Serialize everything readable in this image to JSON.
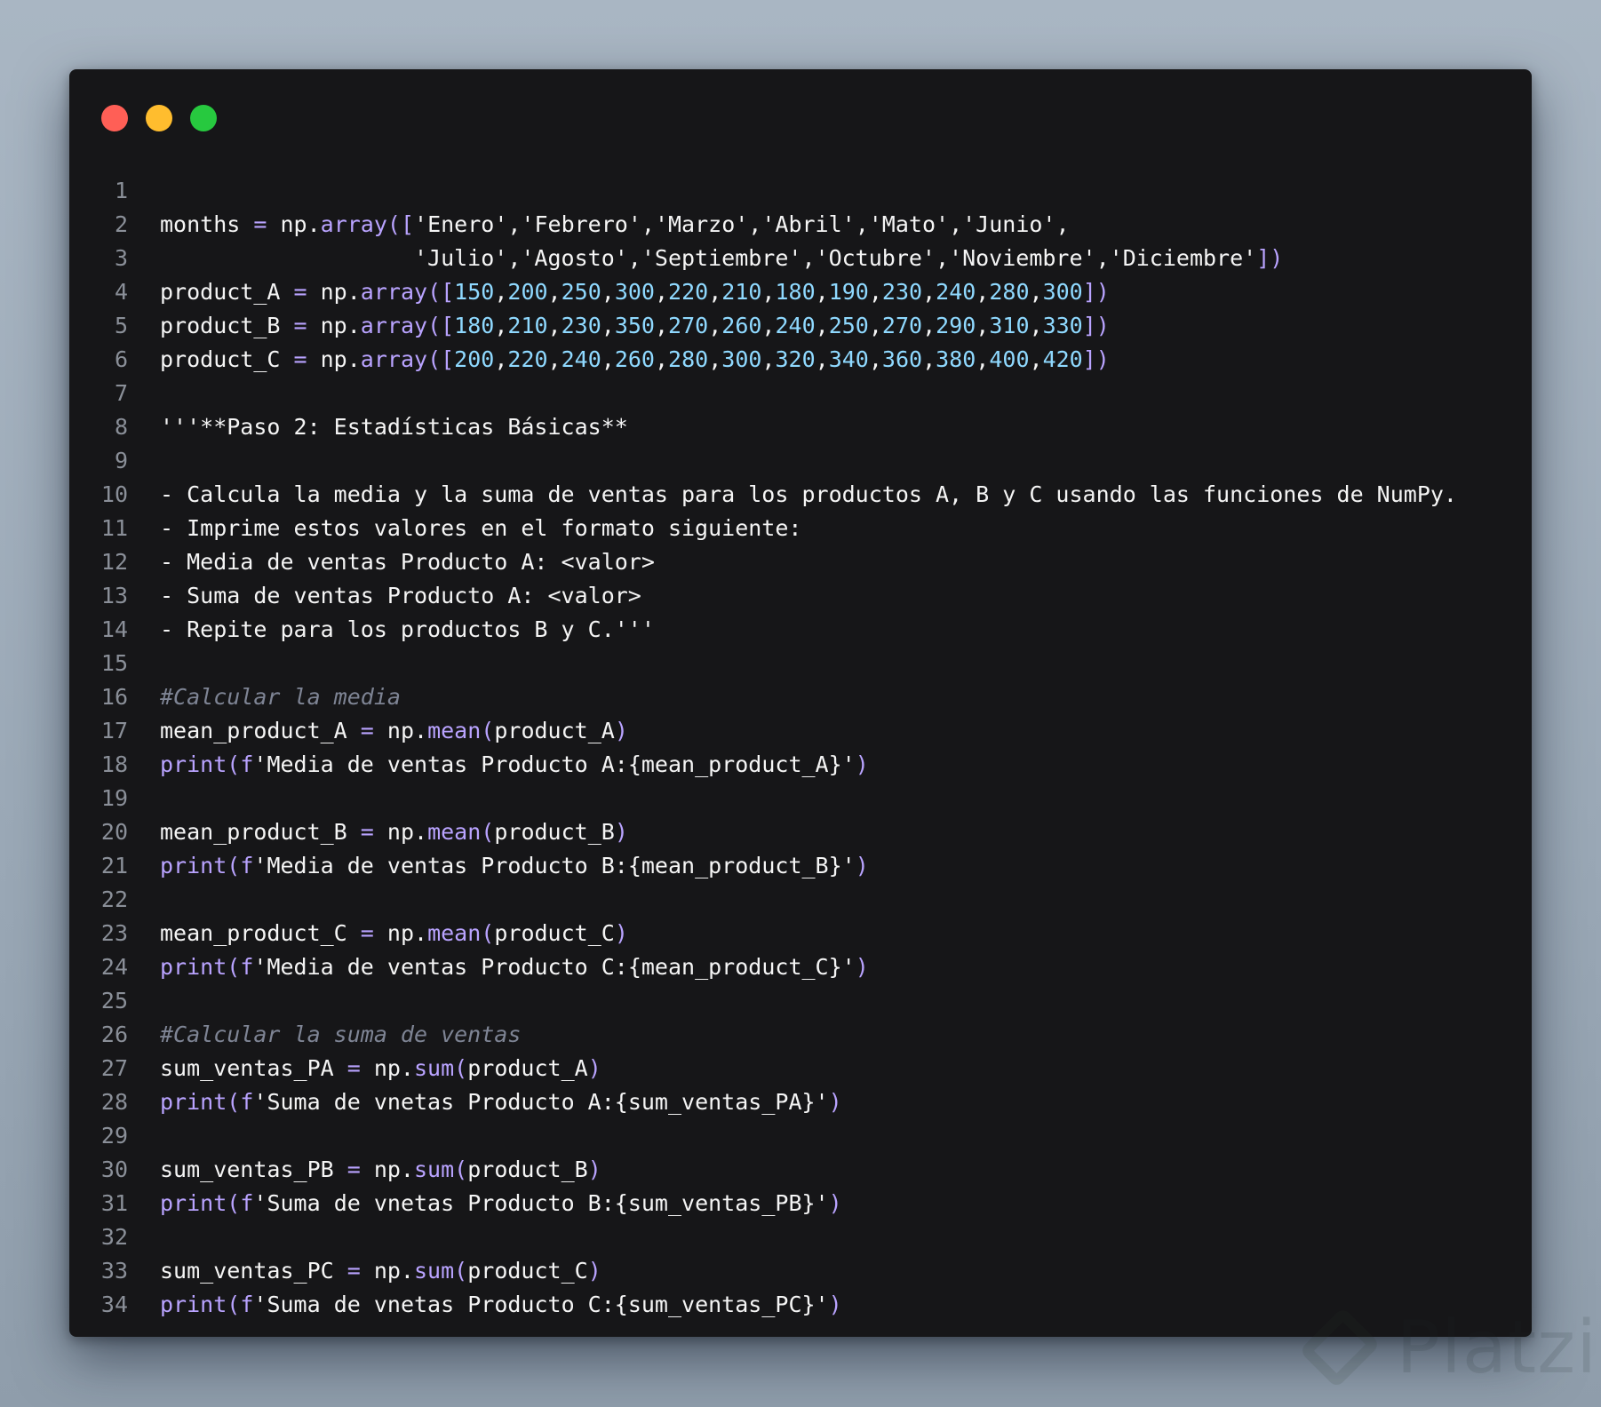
{
  "window": {
    "controls": [
      "close",
      "minimize",
      "maximize"
    ]
  },
  "colors": {
    "background": "#161618",
    "text": "#f5f5f5",
    "function": "#b9a3ff",
    "number": "#8fd9ff",
    "comment": "#7e8494",
    "line_number": "#8a8f98"
  },
  "code_lines": [
    {
      "n": "1",
      "tokens": []
    },
    {
      "n": "2",
      "tokens": [
        {
          "t": "txt",
          "v": "months "
        },
        {
          "t": "op",
          "v": "="
        },
        {
          "t": "txt",
          "v": " np."
        },
        {
          "t": "fn",
          "v": "array"
        },
        {
          "t": "br",
          "v": "(["
        },
        {
          "t": "txt",
          "v": "'Enero','Febrero','Marzo','Abril','Mato','Junio',"
        }
      ]
    },
    {
      "n": "3",
      "tokens": [
        {
          "t": "txt",
          "v": "                   'Julio','Agosto','Septiembre','Octubre','Noviembre','Diciembre'"
        },
        {
          "t": "br",
          "v": "])"
        }
      ]
    },
    {
      "n": "4",
      "tokens": [
        {
          "t": "txt",
          "v": "product_A "
        },
        {
          "t": "op",
          "v": "="
        },
        {
          "t": "txt",
          "v": " np."
        },
        {
          "t": "fn",
          "v": "array"
        },
        {
          "t": "br",
          "v": "(["
        },
        {
          "t": "num",
          "v": "150"
        },
        {
          "t": "txt",
          "v": ","
        },
        {
          "t": "num",
          "v": "200"
        },
        {
          "t": "txt",
          "v": ","
        },
        {
          "t": "num",
          "v": "250"
        },
        {
          "t": "txt",
          "v": ","
        },
        {
          "t": "num",
          "v": "300"
        },
        {
          "t": "txt",
          "v": ","
        },
        {
          "t": "num",
          "v": "220"
        },
        {
          "t": "txt",
          "v": ","
        },
        {
          "t": "num",
          "v": "210"
        },
        {
          "t": "txt",
          "v": ","
        },
        {
          "t": "num",
          "v": "180"
        },
        {
          "t": "txt",
          "v": ","
        },
        {
          "t": "num",
          "v": "190"
        },
        {
          "t": "txt",
          "v": ","
        },
        {
          "t": "num",
          "v": "230"
        },
        {
          "t": "txt",
          "v": ","
        },
        {
          "t": "num",
          "v": "240"
        },
        {
          "t": "txt",
          "v": ","
        },
        {
          "t": "num",
          "v": "280"
        },
        {
          "t": "txt",
          "v": ","
        },
        {
          "t": "num",
          "v": "300"
        },
        {
          "t": "br",
          "v": "])"
        }
      ]
    },
    {
      "n": "5",
      "tokens": [
        {
          "t": "txt",
          "v": "product_B "
        },
        {
          "t": "op",
          "v": "="
        },
        {
          "t": "txt",
          "v": " np."
        },
        {
          "t": "fn",
          "v": "array"
        },
        {
          "t": "br",
          "v": "(["
        },
        {
          "t": "num",
          "v": "180"
        },
        {
          "t": "txt",
          "v": ","
        },
        {
          "t": "num",
          "v": "210"
        },
        {
          "t": "txt",
          "v": ","
        },
        {
          "t": "num",
          "v": "230"
        },
        {
          "t": "txt",
          "v": ","
        },
        {
          "t": "num",
          "v": "350"
        },
        {
          "t": "txt",
          "v": ","
        },
        {
          "t": "num",
          "v": "270"
        },
        {
          "t": "txt",
          "v": ","
        },
        {
          "t": "num",
          "v": "260"
        },
        {
          "t": "txt",
          "v": ","
        },
        {
          "t": "num",
          "v": "240"
        },
        {
          "t": "txt",
          "v": ","
        },
        {
          "t": "num",
          "v": "250"
        },
        {
          "t": "txt",
          "v": ","
        },
        {
          "t": "num",
          "v": "270"
        },
        {
          "t": "txt",
          "v": ","
        },
        {
          "t": "num",
          "v": "290"
        },
        {
          "t": "txt",
          "v": ","
        },
        {
          "t": "num",
          "v": "310"
        },
        {
          "t": "txt",
          "v": ","
        },
        {
          "t": "num",
          "v": "330"
        },
        {
          "t": "br",
          "v": "])"
        }
      ]
    },
    {
      "n": "6",
      "tokens": [
        {
          "t": "txt",
          "v": "product_C "
        },
        {
          "t": "op",
          "v": "="
        },
        {
          "t": "txt",
          "v": " np."
        },
        {
          "t": "fn",
          "v": "array"
        },
        {
          "t": "br",
          "v": "(["
        },
        {
          "t": "num",
          "v": "200"
        },
        {
          "t": "txt",
          "v": ","
        },
        {
          "t": "num",
          "v": "220"
        },
        {
          "t": "txt",
          "v": ","
        },
        {
          "t": "num",
          "v": "240"
        },
        {
          "t": "txt",
          "v": ","
        },
        {
          "t": "num",
          "v": "260"
        },
        {
          "t": "txt",
          "v": ","
        },
        {
          "t": "num",
          "v": "280"
        },
        {
          "t": "txt",
          "v": ","
        },
        {
          "t": "num",
          "v": "300"
        },
        {
          "t": "txt",
          "v": ","
        },
        {
          "t": "num",
          "v": "320"
        },
        {
          "t": "txt",
          "v": ","
        },
        {
          "t": "num",
          "v": "340"
        },
        {
          "t": "txt",
          "v": ","
        },
        {
          "t": "num",
          "v": "360"
        },
        {
          "t": "txt",
          "v": ","
        },
        {
          "t": "num",
          "v": "380"
        },
        {
          "t": "txt",
          "v": ","
        },
        {
          "t": "num",
          "v": "400"
        },
        {
          "t": "txt",
          "v": ","
        },
        {
          "t": "num",
          "v": "420"
        },
        {
          "t": "br",
          "v": "])"
        }
      ]
    },
    {
      "n": "7",
      "tokens": []
    },
    {
      "n": "8",
      "tokens": [
        {
          "t": "txt",
          "v": "'''**Paso 2: Estadísticas Básicas**"
        }
      ]
    },
    {
      "n": "9",
      "tokens": []
    },
    {
      "n": "10",
      "tokens": [
        {
          "t": "txt",
          "v": "- Calcula la media y la suma de ventas para los productos A, B y C usando las funciones de NumPy."
        }
      ]
    },
    {
      "n": "11",
      "tokens": [
        {
          "t": "txt",
          "v": "- Imprime estos valores en el formato siguiente:"
        }
      ]
    },
    {
      "n": "12",
      "tokens": [
        {
          "t": "txt",
          "v": "- Media de ventas Producto A: <valor>"
        }
      ]
    },
    {
      "n": "13",
      "tokens": [
        {
          "t": "txt",
          "v": "- Suma de ventas Producto A: <valor>"
        }
      ]
    },
    {
      "n": "14",
      "tokens": [
        {
          "t": "txt",
          "v": "- Repite para los productos B y C.'''"
        }
      ]
    },
    {
      "n": "15",
      "tokens": []
    },
    {
      "n": "16",
      "tokens": [
        {
          "t": "com",
          "v": "#Calcular la media"
        }
      ]
    },
    {
      "n": "17",
      "tokens": [
        {
          "t": "txt",
          "v": "mean_product_A "
        },
        {
          "t": "op",
          "v": "="
        },
        {
          "t": "txt",
          "v": " np."
        },
        {
          "t": "fn",
          "v": "mean"
        },
        {
          "t": "br",
          "v": "("
        },
        {
          "t": "txt",
          "v": "product_A"
        },
        {
          "t": "br",
          "v": ")"
        }
      ]
    },
    {
      "n": "18",
      "tokens": [
        {
          "t": "fn",
          "v": "print"
        },
        {
          "t": "br",
          "v": "("
        },
        {
          "t": "fn",
          "v": "f"
        },
        {
          "t": "txt",
          "v": "'Media de ventas Producto A:{mean_product_A}'"
        },
        {
          "t": "br",
          "v": ")"
        }
      ]
    },
    {
      "n": "19",
      "tokens": []
    },
    {
      "n": "20",
      "tokens": [
        {
          "t": "txt",
          "v": "mean_product_B "
        },
        {
          "t": "op",
          "v": "="
        },
        {
          "t": "txt",
          "v": " np."
        },
        {
          "t": "fn",
          "v": "mean"
        },
        {
          "t": "br",
          "v": "("
        },
        {
          "t": "txt",
          "v": "product_B"
        },
        {
          "t": "br",
          "v": ")"
        }
      ]
    },
    {
      "n": "21",
      "tokens": [
        {
          "t": "fn",
          "v": "print"
        },
        {
          "t": "br",
          "v": "("
        },
        {
          "t": "fn",
          "v": "f"
        },
        {
          "t": "txt",
          "v": "'Media de ventas Producto B:{mean_product_B}'"
        },
        {
          "t": "br",
          "v": ")"
        }
      ]
    },
    {
      "n": "22",
      "tokens": []
    },
    {
      "n": "23",
      "tokens": [
        {
          "t": "txt",
          "v": "mean_product_C "
        },
        {
          "t": "op",
          "v": "="
        },
        {
          "t": "txt",
          "v": " np."
        },
        {
          "t": "fn",
          "v": "mean"
        },
        {
          "t": "br",
          "v": "("
        },
        {
          "t": "txt",
          "v": "product_C"
        },
        {
          "t": "br",
          "v": ")"
        }
      ]
    },
    {
      "n": "24",
      "tokens": [
        {
          "t": "fn",
          "v": "print"
        },
        {
          "t": "br",
          "v": "("
        },
        {
          "t": "fn",
          "v": "f"
        },
        {
          "t": "txt",
          "v": "'Media de ventas Producto C:{mean_product_C}'"
        },
        {
          "t": "br",
          "v": ")"
        }
      ]
    },
    {
      "n": "25",
      "tokens": []
    },
    {
      "n": "26",
      "tokens": [
        {
          "t": "com",
          "v": "#Calcular la suma de ventas"
        }
      ]
    },
    {
      "n": "27",
      "tokens": [
        {
          "t": "txt",
          "v": "sum_ventas_PA "
        },
        {
          "t": "op",
          "v": "="
        },
        {
          "t": "txt",
          "v": " np."
        },
        {
          "t": "fn",
          "v": "sum"
        },
        {
          "t": "br",
          "v": "("
        },
        {
          "t": "txt",
          "v": "product_A"
        },
        {
          "t": "br",
          "v": ")"
        }
      ]
    },
    {
      "n": "28",
      "tokens": [
        {
          "t": "fn",
          "v": "print"
        },
        {
          "t": "br",
          "v": "("
        },
        {
          "t": "fn",
          "v": "f"
        },
        {
          "t": "txt",
          "v": "'Suma de vnetas Producto A:{sum_ventas_PA}'"
        },
        {
          "t": "br",
          "v": ")"
        }
      ]
    },
    {
      "n": "29",
      "tokens": []
    },
    {
      "n": "30",
      "tokens": [
        {
          "t": "txt",
          "v": "sum_ventas_PB "
        },
        {
          "t": "op",
          "v": "="
        },
        {
          "t": "txt",
          "v": " np."
        },
        {
          "t": "fn",
          "v": "sum"
        },
        {
          "t": "br",
          "v": "("
        },
        {
          "t": "txt",
          "v": "product_B"
        },
        {
          "t": "br",
          "v": ")"
        }
      ]
    },
    {
      "n": "31",
      "tokens": [
        {
          "t": "fn",
          "v": "print"
        },
        {
          "t": "br",
          "v": "("
        },
        {
          "t": "fn",
          "v": "f"
        },
        {
          "t": "txt",
          "v": "'Suma de vnetas Producto B:{sum_ventas_PB}'"
        },
        {
          "t": "br",
          "v": ")"
        }
      ]
    },
    {
      "n": "32",
      "tokens": []
    },
    {
      "n": "33",
      "tokens": [
        {
          "t": "txt",
          "v": "sum_ventas_PC "
        },
        {
          "t": "op",
          "v": "="
        },
        {
          "t": "txt",
          "v": " np."
        },
        {
          "t": "fn",
          "v": "sum"
        },
        {
          "t": "br",
          "v": "("
        },
        {
          "t": "txt",
          "v": "product_C"
        },
        {
          "t": "br",
          "v": ")"
        }
      ]
    },
    {
      "n": "34",
      "tokens": [
        {
          "t": "fn",
          "v": "print"
        },
        {
          "t": "br",
          "v": "("
        },
        {
          "t": "fn",
          "v": "f"
        },
        {
          "t": "txt",
          "v": "'Suma de vnetas Producto C:{sum_ventas_PC}'"
        },
        {
          "t": "br",
          "v": ")"
        }
      ]
    }
  ],
  "watermark": {
    "text": "Platzi"
  }
}
